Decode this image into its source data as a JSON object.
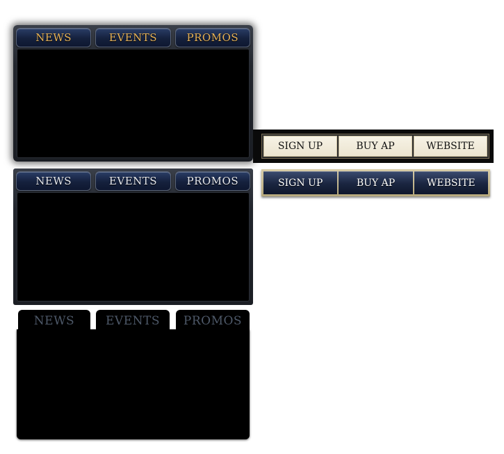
{
  "panel_1": {
    "tabs": [
      "NEWS",
      "EVENTS",
      "PROMOS"
    ],
    "tab_color": "#e7b257"
  },
  "panel_2": {
    "tabs": [
      "NEWS",
      "EVENTS",
      "PROMOS"
    ],
    "tab_color": "#e6e8ee"
  },
  "panel_3": {
    "tabs": [
      "NEWS",
      "EVENTS",
      "PROMOS"
    ],
    "tab_color": "#4e5969"
  },
  "nav_a": {
    "buttons": [
      "SIGN UP",
      "BUY AP",
      "WEBSITE"
    ]
  },
  "nav_b": {
    "buttons": [
      "SIGN UP",
      "BUY AP",
      "WEBSITE"
    ]
  }
}
